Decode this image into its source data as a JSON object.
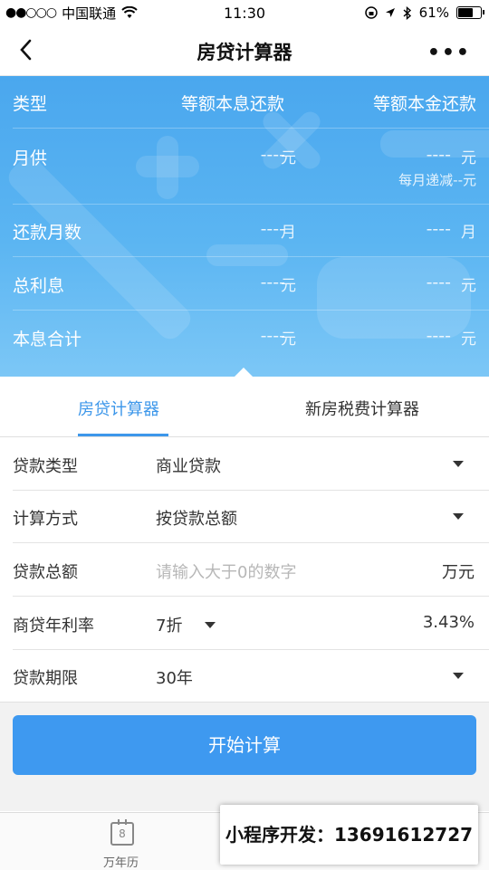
{
  "status": {
    "signal": "●●○○○",
    "carrier": "中国联通",
    "time": "11:30",
    "battery": "61%"
  },
  "nav": {
    "title": "房贷计算器"
  },
  "summary": {
    "header": {
      "label": "类型",
      "col1": "等额本息还款",
      "col2": "等额本金还款"
    },
    "rows": [
      {
        "label": "月供",
        "v1": "----",
        "u1": "元",
        "v2": "----",
        "u2": "元",
        "sub": "每月递减--元"
      },
      {
        "label": "还款月数",
        "v1": "----",
        "u1": "月",
        "v2": "----",
        "u2": "月"
      },
      {
        "label": "总利息",
        "v1": "----",
        "u1": "元",
        "v2": "----",
        "u2": "元"
      },
      {
        "label": "本息合计",
        "v1": "----",
        "u1": "元",
        "v2": "----",
        "u2": "元"
      }
    ]
  },
  "tabs": [
    {
      "label": "房贷计算器",
      "active": true
    },
    {
      "label": "新房税费计算器",
      "active": false
    }
  ],
  "form": {
    "loan_type": {
      "label": "贷款类型",
      "value": "商业贷款"
    },
    "calc_method": {
      "label": "计算方式",
      "value": "按贷款总额"
    },
    "loan_amount": {
      "label": "贷款总额",
      "placeholder": "请输入大于0的数字",
      "unit": "万元"
    },
    "rate": {
      "label": "商贷年利率",
      "discount": "7折",
      "value": "3.43%"
    },
    "term": {
      "label": "贷款期限",
      "value": "30年"
    }
  },
  "submit_label": "开始计算",
  "tabbar": {
    "calendar_day": "8",
    "item1": "万年历"
  },
  "ad_text": "小程序开发：13691612727",
  "colors": {
    "accent": "#3e99f0",
    "hero": "#4aa7ee"
  }
}
